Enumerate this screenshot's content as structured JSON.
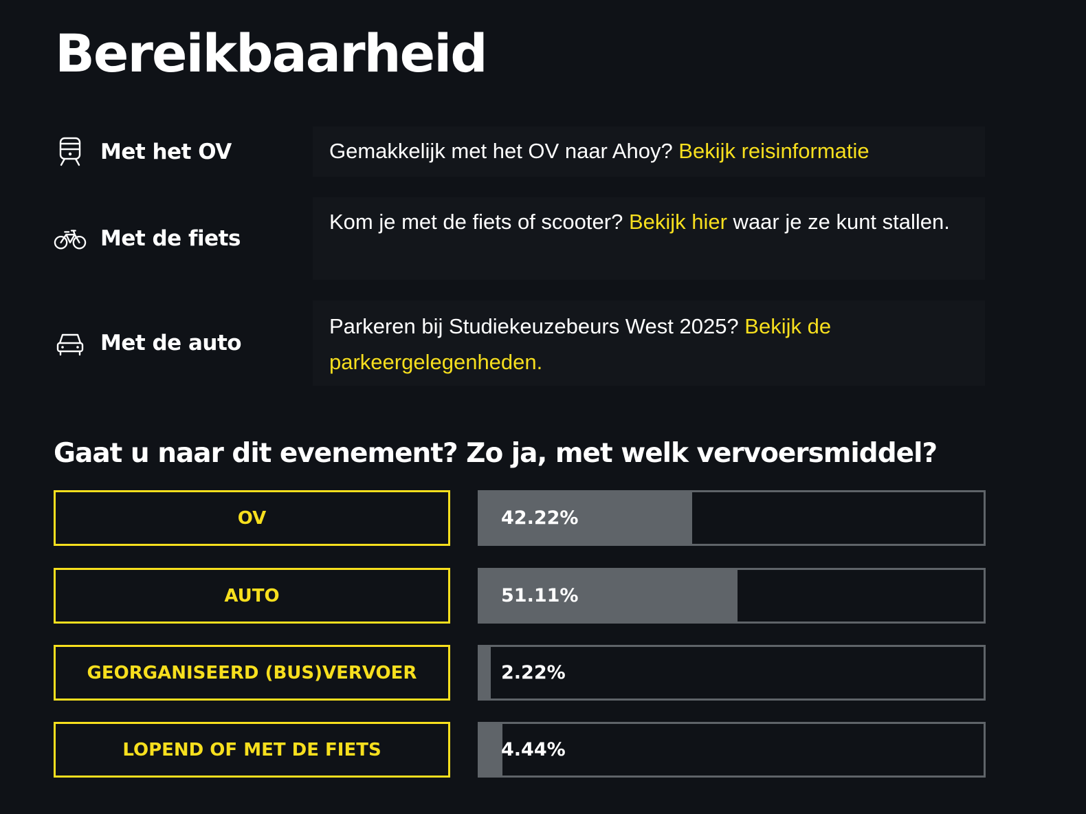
{
  "page_title": "Bereikbaarheid",
  "modes": [
    {
      "icon": "train-icon",
      "label": "Met het OV",
      "text_before": "Gemakkelijk met het OV naar Ahoy? ",
      "link": "Bekijk reisinformatie",
      "text_after": ""
    },
    {
      "icon": "bike-icon",
      "label": "Met de fiets",
      "text_before": "Kom je met de fiets of scooter? ",
      "link": "Bekijk hier",
      "text_after": " waar je ze kunt stallen."
    },
    {
      "icon": "car-icon",
      "label": "Met de auto",
      "text_before": "Parkeren bij Studiekeuzebeurs West 2025? ",
      "link": "Bekijk de parkeergelegenheden.",
      "text_after": ""
    }
  ],
  "poll": {
    "question": "Gaat u naar dit evenement? Zo ja, met welk vervoersmiddel?",
    "options": [
      {
        "label": "OV",
        "percent_label": "42.22%",
        "percent": 42.22
      },
      {
        "label": "AUTO",
        "percent_label": "51.11%",
        "percent": 51.11
      },
      {
        "label": "GEORGANISEERD (BUS)VERVOER",
        "percent_label": "2.22%",
        "percent": 2.22
      },
      {
        "label": "LOPEND OF MET DE FIETS",
        "percent_label": "4.44%",
        "percent": 4.44
      }
    ]
  },
  "colors": {
    "background": "#0f1217",
    "panel": "#13161b",
    "accent": "#f7df1e",
    "bar": "#5f6469",
    "text": "#ffffff"
  }
}
